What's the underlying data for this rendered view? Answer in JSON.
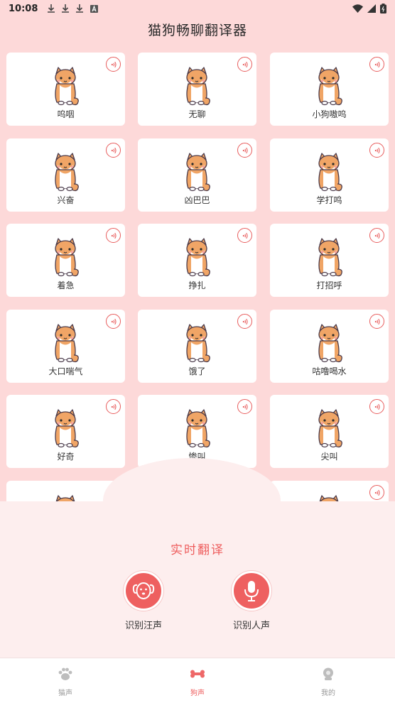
{
  "status_bar": {
    "time": "10:08"
  },
  "header": {
    "title": "猫狗畅聊翻译器"
  },
  "cards": [
    {
      "label": "呜咽"
    },
    {
      "label": "无聊"
    },
    {
      "label": "小狗嗷呜"
    },
    {
      "label": "兴奋"
    },
    {
      "label": "凶巴巴"
    },
    {
      "label": "学打鸣"
    },
    {
      "label": "着急"
    },
    {
      "label": "挣扎"
    },
    {
      "label": "打招呼"
    },
    {
      "label": "大口喘气"
    },
    {
      "label": "饿了"
    },
    {
      "label": "咕噜喝水"
    },
    {
      "label": "好奇"
    },
    {
      "label": "惨叫"
    },
    {
      "label": "尖叫"
    },
    {
      "label": ""
    },
    {
      "label": ""
    },
    {
      "label": ""
    }
  ],
  "panel": {
    "title": "实时翻译",
    "actions": [
      {
        "label": "识别汪声",
        "icon": "dog-icon"
      },
      {
        "label": "识别人声",
        "icon": "microphone-icon"
      }
    ]
  },
  "tabs": [
    {
      "label": "猫声",
      "icon": "paw-icon",
      "active": false
    },
    {
      "label": "狗声",
      "icon": "bone-icon",
      "active": true
    },
    {
      "label": "我的",
      "icon": "profile-icon",
      "active": false
    }
  ],
  "colors": {
    "accent": "#ee5e5e",
    "background": "#fdd9d9",
    "panel": "#fdeeee"
  }
}
